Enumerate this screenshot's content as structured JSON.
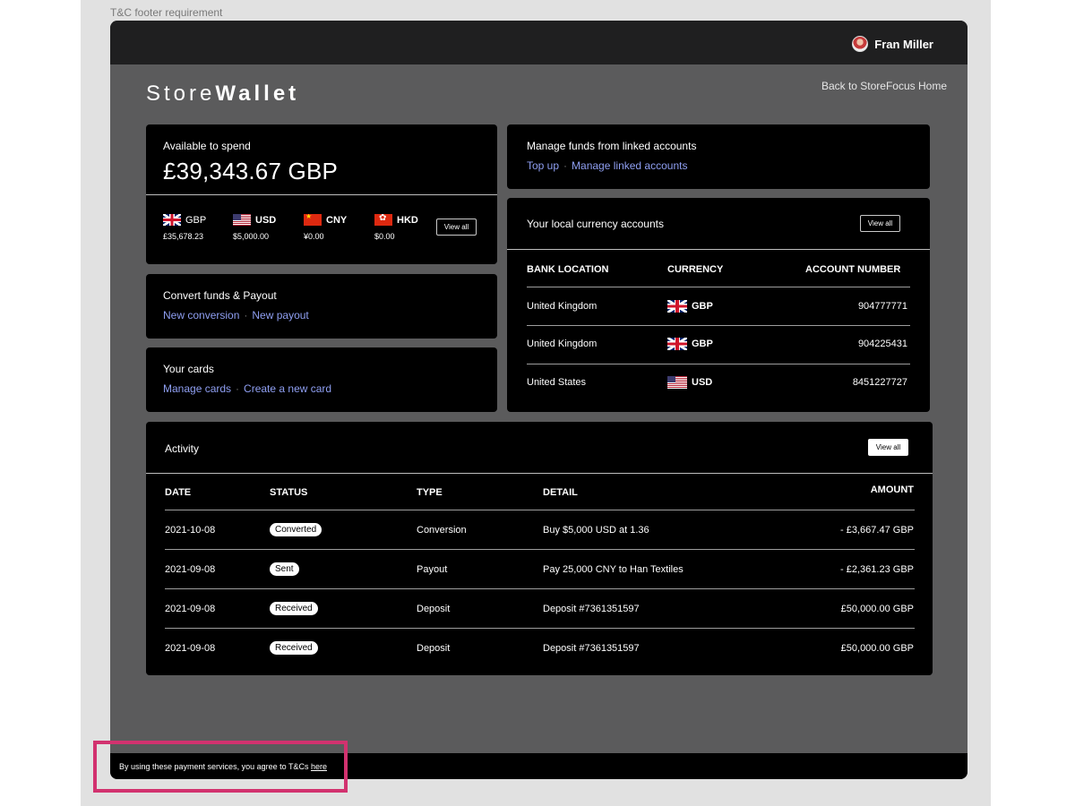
{
  "frame_caption": "T&C footer requirement",
  "header": {
    "user_name": "Fran Miller"
  },
  "brand": {
    "prefix": "Store",
    "suffix": "Wallet"
  },
  "nav": {
    "back_label": "Back to StoreFocus Home"
  },
  "balance_card": {
    "label": "Available to spend",
    "amount": "£39,343.67 GBP",
    "currencies": [
      {
        "code": "GBP",
        "amount": "£35,678.23",
        "icon": "uk-flag-icon"
      },
      {
        "code": "USD",
        "amount": "$5,000.00",
        "icon": "us-flag-icon"
      },
      {
        "code": "CNY",
        "amount": "¥0.00",
        "icon": "cn-flag-icon"
      },
      {
        "code": "HKD",
        "amount": "$0.00",
        "icon": "hk-flag-icon"
      }
    ],
    "view_all_label": "View all"
  },
  "linked_accounts": {
    "label": "Manage funds from linked accounts",
    "links": [
      "Top up",
      "Manage linked accounts"
    ]
  },
  "convert": {
    "label": "Convert funds & Payout",
    "links": [
      "New conversion",
      "New payout"
    ]
  },
  "cards": {
    "label": "Your cards",
    "links": [
      "Manage cards",
      "Create a new card"
    ]
  },
  "local_accounts": {
    "label": "Your local currency accounts",
    "view_all_label": "View all",
    "columns": [
      "BANK LOCATION",
      "CURRENCY",
      "ACCOUNT NUMBER"
    ],
    "rows": [
      {
        "location": "United Kingdom",
        "currency": "GBP",
        "account": "904777771",
        "icon": "uk-flag-icon"
      },
      {
        "location": "United Kingdom",
        "currency": "GBP",
        "account": "904225431",
        "icon": "uk-flag-icon"
      },
      {
        "location": "United States",
        "currency": "USD",
        "account": "8451227727",
        "icon": "us-flag-icon"
      }
    ]
  },
  "activity": {
    "label": "Activity",
    "view_all_label": "View all",
    "columns": [
      "DATE",
      "STATUS",
      "TYPE",
      "DETAIL",
      "AMOUNT"
    ],
    "rows": [
      {
        "date": "2021-10-08",
        "status": "Converted",
        "type": "Conversion",
        "detail": "Buy $5,000 USD at 1.36",
        "amount": "- £3,667.47 GBP"
      },
      {
        "date": "2021-09-08",
        "status": "Sent",
        "type": "Payout",
        "detail": "Pay 25,000 CNY to Han Textiles",
        "amount": "- £2,361.23 GBP"
      },
      {
        "date": "2021-09-08",
        "status": "Received",
        "type": "Deposit",
        "detail": "Deposit #7361351597",
        "amount": "£50,000.00 GBP"
      },
      {
        "date": "2021-09-08",
        "status": "Received",
        "type": "Deposit",
        "detail": "Deposit #7361351597",
        "amount": "£50,000.00 GBP"
      }
    ]
  },
  "footer": {
    "text": "By using these payment services, you agree to T&Cs ",
    "link": "here"
  },
  "colors": {
    "accent_link": "#8f9ff2",
    "highlight": "#d2326f",
    "panel": "#000000",
    "app_bg": "#5b5b5c"
  }
}
